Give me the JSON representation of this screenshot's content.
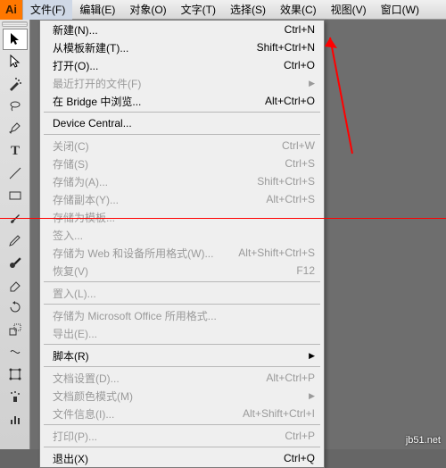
{
  "app_icon_text": "Ai",
  "menubar": {
    "file": "文件(F)",
    "edit": "编辑(E)",
    "object": "对象(O)",
    "type": "文字(T)",
    "select": "选择(S)",
    "effect": "效果(C)",
    "view": "视图(V)",
    "window": "窗口(W)"
  },
  "dropdown": {
    "new": {
      "label": "新建(N)...",
      "shortcut": "Ctrl+N"
    },
    "new_template": {
      "label": "从模板新建(T)...",
      "shortcut": "Shift+Ctrl+N"
    },
    "open": {
      "label": "打开(O)...",
      "shortcut": "Ctrl+O"
    },
    "recent": {
      "label": "最近打开的文件(F)",
      "shortcut": ""
    },
    "bridge": {
      "label": "在 Bridge 中浏览...",
      "shortcut": "Alt+Ctrl+O"
    },
    "device_central": {
      "label": "Device Central...",
      "shortcut": ""
    },
    "close": {
      "label": "关闭(C)",
      "shortcut": "Ctrl+W"
    },
    "save": {
      "label": "存储(S)",
      "shortcut": "Ctrl+S"
    },
    "save_as": {
      "label": "存储为(A)...",
      "shortcut": "Shift+Ctrl+S"
    },
    "save_copy": {
      "label": "存储副本(Y)...",
      "shortcut": "Alt+Ctrl+S"
    },
    "save_template": {
      "label": "存储为模板...",
      "shortcut": ""
    },
    "checkin": {
      "label": "签入...",
      "shortcut": ""
    },
    "save_web": {
      "label": "存储为 Web 和设备所用格式(W)...",
      "shortcut": "Alt+Shift+Ctrl+S"
    },
    "revert": {
      "label": "恢复(V)",
      "shortcut": "F12"
    },
    "place": {
      "label": "置入(L)...",
      "shortcut": ""
    },
    "save_office": {
      "label": "存储为 Microsoft Office 所用格式...",
      "shortcut": ""
    },
    "export": {
      "label": "导出(E)...",
      "shortcut": ""
    },
    "scripts": {
      "label": "脚本(R)",
      "shortcut": ""
    },
    "doc_setup": {
      "label": "文档设置(D)...",
      "shortcut": "Alt+Ctrl+P"
    },
    "color_mode": {
      "label": "文档颜色模式(M)",
      "shortcut": ""
    },
    "file_info": {
      "label": "文件信息(I)...",
      "shortcut": "Alt+Shift+Ctrl+I"
    },
    "print": {
      "label": "打印(P)...",
      "shortcut": "Ctrl+P"
    },
    "exit": {
      "label": "退出(X)",
      "shortcut": "Ctrl+Q"
    }
  },
  "watermark": "jb51.net",
  "arrow_symbol": "▶"
}
